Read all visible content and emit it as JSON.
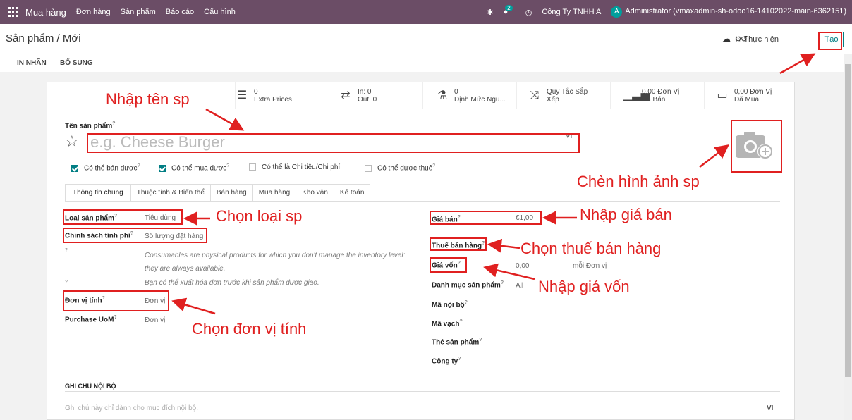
{
  "topbar": {
    "app": "Mua hàng",
    "menus": [
      "Đơn hàng",
      "Sản phẩm",
      "Báo cáo",
      "Cấu hình"
    ],
    "msg_count": "2",
    "company": "Công Ty TNHH A",
    "avatar_letter": "A",
    "user": "Administrator (vmaxadmin-sh-odoo16-14102022-main-6362151)"
  },
  "control": {
    "breadcrumb": "Sản phẩm / Mới",
    "action": "Thực hiện",
    "create": "Tạo"
  },
  "header_buttons": {
    "print": "IN NHÃN",
    "more": "BỔ SUNG"
  },
  "smart_buttons": [
    {
      "icon": "list-icon",
      "l1": "0",
      "l2": "Extra Prices"
    },
    {
      "icon": "transfer-icon",
      "l1": "In:  0",
      "l2": "Out: 0"
    },
    {
      "icon": "flask-icon",
      "l1": "0",
      "l2": "Định Mức Ngu..."
    },
    {
      "icon": "shuffle-icon",
      "l1": "Quy Tắc Sắp",
      "l2": "Xếp"
    },
    {
      "icon": "chart-icon",
      "l1": "0,00 Đơn Vị",
      "l2": "Đã Bán"
    },
    {
      "icon": "card-icon",
      "l1": "0,00 Đơn Vị",
      "l2": "Đã Mua"
    }
  ],
  "form": {
    "name_label": "Tên sản phẩm",
    "name_placeholder": "e.g. Cheese Burger",
    "lang": "VI",
    "checks": [
      {
        "label": "Có thể bán được",
        "checked": true
      },
      {
        "label": "Có thể mua được",
        "checked": true
      },
      {
        "label": "Có thể là Chi tiêu/Chi phí",
        "checked": false
      },
      {
        "label": "Có thể được thuê",
        "checked": false
      }
    ],
    "tabs": [
      "Thông tin chung",
      "Thuộc tính & Biến thể",
      "Bán hàng",
      "Mua hàng",
      "Kho vận",
      "Kế toán"
    ],
    "left": {
      "type_label": "Loại sản phẩm",
      "type_value": "Tiêu dùng",
      "policy_label": "Chính sách tính phí",
      "policy_value": "Số lượng đặt hàng",
      "note1": "Consumables are physical products for which you don't manage the inventory level: they are always available.",
      "note2": "Bạn có thể xuất hóa đơn trước khi sản phẩm được giao.",
      "uom_label": "Đơn vị tính",
      "uom_value": "Đơn vị",
      "puom_label": "Purchase UoM",
      "puom_value": "Đơn vị"
    },
    "right": {
      "price_label": "Giá bán",
      "price_value": "€1,00",
      "tax_label": "Thuế bán hàng",
      "cost_label": "Giá vốn",
      "cost_value": "0,00",
      "cost_unit": "mỗi Đơn vị",
      "categ_label": "Danh mục sản phẩm",
      "categ_value": "All",
      "ref_label": "Mã nội bộ",
      "barcode_label": "Mã vạch",
      "tags_label": "Thẻ sản phẩm",
      "company_label": "Công ty"
    },
    "internal_notes_label": "GHI CHÚ NỘI BỘ",
    "internal_notes_placeholder": "Ghi chú này chỉ dành cho mục đích nội bộ.",
    "notes_lang": "VI"
  },
  "annotations": {
    "name": "Nhập tên sp",
    "image": "Chèn hình ảnh sp",
    "type": "Chọn loại sp",
    "price": "Nhập giá bán",
    "tax": "Chọn thuế bán hàng",
    "cost": "Nhập giá vốn",
    "uom": "Chọn đơn vị tính"
  }
}
